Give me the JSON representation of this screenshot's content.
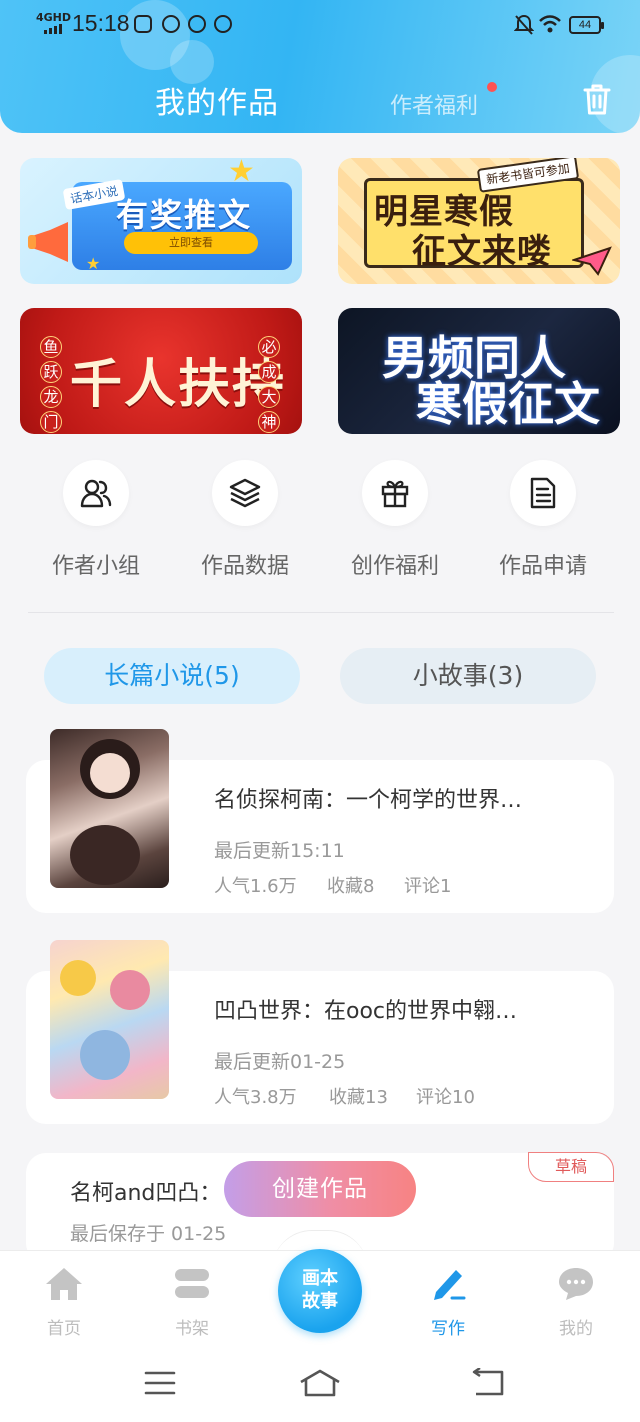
{
  "status_bar": {
    "network": "4GHD",
    "time": "15:18",
    "battery": "44"
  },
  "header": {
    "title": "我的作品",
    "benefit_link": "作者福利"
  },
  "banners": {
    "b1": {
      "tag": "话本小说",
      "title": "有奖推文",
      "button": "立即查看"
    },
    "b2": {
      "tag": "新老书皆可参加",
      "line1": "明星寒假",
      "line2": "征文来喽"
    },
    "b3": {
      "title": "千人扶持",
      "left_chars": [
        "鱼",
        "跃",
        "龙",
        "门"
      ],
      "right_chars": [
        "必",
        "成",
        "大",
        "神"
      ]
    },
    "b4": {
      "line1": "男频同人",
      "line2": "寒假征文"
    }
  },
  "features": [
    {
      "label": "作者小组",
      "icon": "users-icon"
    },
    {
      "label": "作品数据",
      "icon": "layers-icon"
    },
    {
      "label": "创作福利",
      "icon": "gift-icon"
    },
    {
      "label": "作品申请",
      "icon": "document-icon"
    }
  ],
  "tabs": [
    {
      "label": "长篇小说(5)",
      "active": true
    },
    {
      "label": "小故事(3)",
      "active": false
    }
  ],
  "works": [
    {
      "title": "名侦探柯南：一个柯学的世界…",
      "updated": "最后更新15:11",
      "popularity": "人气1.6万",
      "favorites": "收藏8",
      "comments": "评论1"
    },
    {
      "title": "凹凸世界：在ooc的世界中翱…",
      "updated": "最后更新01-25",
      "popularity": "人气3.8万",
      "favorites": "收藏13",
      "comments": "评论10"
    }
  ],
  "draft": {
    "title": "名柯and凹凸：",
    "saved": "最后保存于 01-25",
    "badge": "草稿"
  },
  "create_button": "创建作品",
  "bottom_nav": [
    {
      "label": "首页",
      "icon": "home-icon"
    },
    {
      "label": "书架",
      "icon": "bookshelf-icon"
    },
    {
      "label": "写作",
      "icon": "pen-icon",
      "active": true
    },
    {
      "label": "我的",
      "icon": "chat-bubble-icon"
    }
  ],
  "center_button": {
    "line1": "画本",
    "line2": "故事"
  },
  "colors": {
    "accent": "#1f97e8",
    "header_gradient_start": "#4fc3f7",
    "create_gradient_end": "#f78383"
  }
}
